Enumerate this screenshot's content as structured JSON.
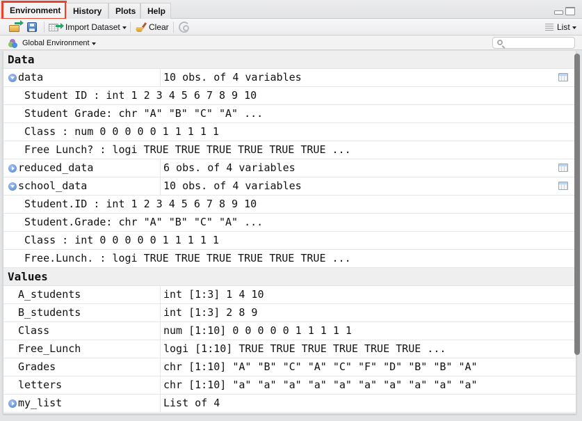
{
  "tabs": [
    {
      "label": "Environment",
      "active": true
    },
    {
      "label": "History",
      "active": false
    },
    {
      "label": "Plots",
      "active": false
    },
    {
      "label": "Help",
      "active": false
    }
  ],
  "window_controls": {
    "minimize": "minimize-icon",
    "maximize": "maximize-icon"
  },
  "toolbar": {
    "open_icon": "open-folder-icon",
    "save_icon": "save-icon",
    "import_label": "Import Dataset",
    "clear_label": "Clear",
    "refresh_icon": "refresh-icon",
    "view_label": "List"
  },
  "env_bar": {
    "environment_label": "Global Environment",
    "search": {
      "value": "",
      "placeholder": ""
    }
  },
  "sections": {
    "data": {
      "title": "Data",
      "items": [
        {
          "name": "data",
          "value": "10 obs. of 4 variables",
          "expanded": true,
          "viewable": true,
          "children": [
            "Student ID : int 1 2 3 4 5 6 7 8 9 10",
            "Student Grade: chr \"A\" \"B\" \"C\" \"A\" ...",
            "Class : num 0 0 0 0 0 1 1 1 1 1",
            "Free Lunch? : logi TRUE TRUE TRUE TRUE TRUE TRUE ..."
          ]
        },
        {
          "name": "reduced_data",
          "value": "6 obs. of 4 variables",
          "expanded": false,
          "viewable": true,
          "children": []
        },
        {
          "name": "school_data",
          "value": "10 obs. of 4 variables",
          "expanded": true,
          "viewable": true,
          "children": [
            "Student.ID : int 1 2 3 4 5 6 7 8 9 10",
            "Student.Grade: chr \"A\" \"B\" \"C\" \"A\" ...",
            "Class : int 0 0 0 0 0 1 1 1 1 1",
            "Free.Lunch. : logi TRUE TRUE TRUE TRUE TRUE TRUE ..."
          ]
        }
      ]
    },
    "values": {
      "title": "Values",
      "items": [
        {
          "name": "A_students",
          "value": "int [1:3] 1 4 10"
        },
        {
          "name": "B_students",
          "value": "int [1:3] 2 8 9"
        },
        {
          "name": "Class",
          "value": "num [1:10] 0 0 0 0 0 1 1 1 1 1"
        },
        {
          "name": "Free_Lunch",
          "value": "logi [1:10] TRUE TRUE TRUE TRUE TRUE TRUE ..."
        },
        {
          "name": "Grades",
          "value": "chr [1:10] \"A\" \"B\" \"C\" \"A\" \"C\" \"F\" \"D\" \"B\" \"B\" \"A\""
        },
        {
          "name": "letters",
          "value": "chr [1:10] \"a\" \"a\" \"a\" \"a\" \"a\" \"a\" \"a\" \"a\" \"a\" \"a\""
        },
        {
          "name": "my_list",
          "value": "List of 4",
          "expandable": true
        }
      ]
    }
  },
  "colors": {
    "active_tab_highlight": "#e8432e",
    "expander_blue": "#4c7fd1",
    "scrollbar_thumb": "#7f7f7f"
  }
}
